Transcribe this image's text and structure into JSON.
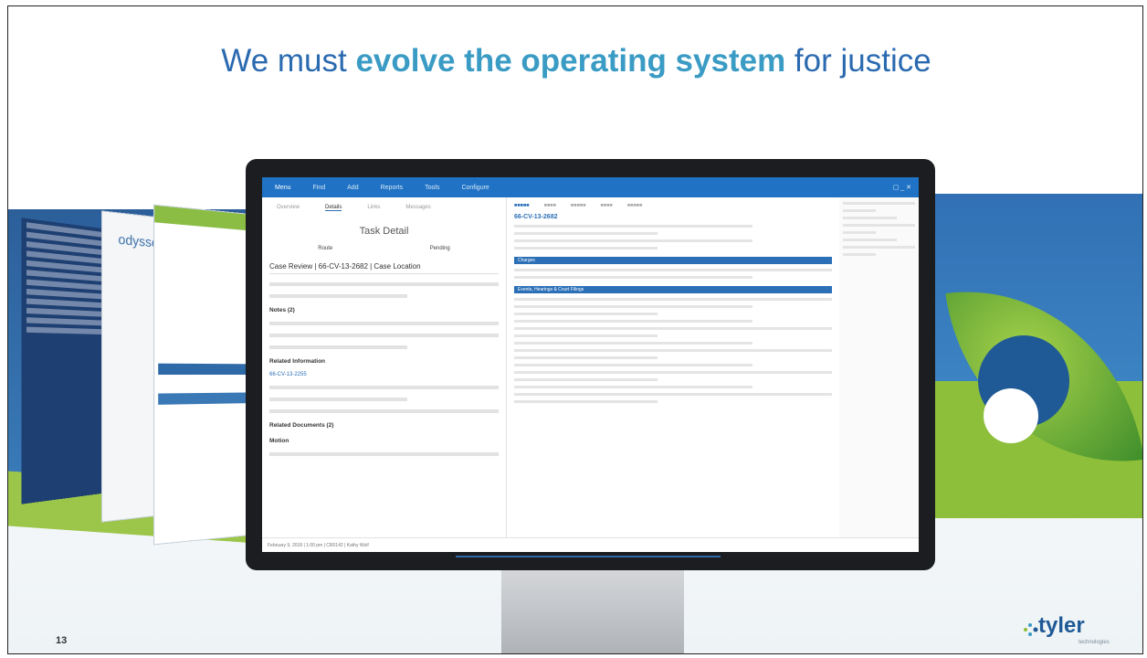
{
  "slide": {
    "title_prefix": "We must ",
    "title_highlight": "evolve the operating system",
    "title_suffix": " for justice",
    "page_number": "13",
    "brand": "tyler",
    "brand_sub": "technologies"
  },
  "background_screens": {
    "odyssey_logo": "odyssey"
  },
  "app": {
    "menu": [
      "Menu",
      "Find",
      "Add",
      "Reports",
      "Tools",
      "Configure"
    ],
    "window_controls": "▢ _ ✕",
    "left_tabs": [
      "Overview",
      "Details",
      "Links",
      "Messages"
    ],
    "task_title": "Task Detail",
    "task_row": [
      "Route",
      "Pending"
    ],
    "case_heading": "Case Review | 66-CV-13-2682 | Case Location",
    "notes_heading": "Notes (2)",
    "related_info_heading": "Related Information",
    "related_case_link": "66-CV-13-2255",
    "related_docs_heading": "Related Documents (2)",
    "related_docs_first": "Motion",
    "status_bar": "February 9, 2018 | 1:00 pm | CR0142 | Kathy Wolf",
    "case_number": "66-CV-13-2682",
    "charges_bar": "Charges",
    "events_bar": "Events, Hearings & Court Filings"
  },
  "colors": {
    "title": "#2a6ab0",
    "highlight": "#3a9bc4",
    "app_menu": "#1f72c4",
    "band_blue": "#2c5f9a",
    "band_green": "#8dbf3a"
  }
}
